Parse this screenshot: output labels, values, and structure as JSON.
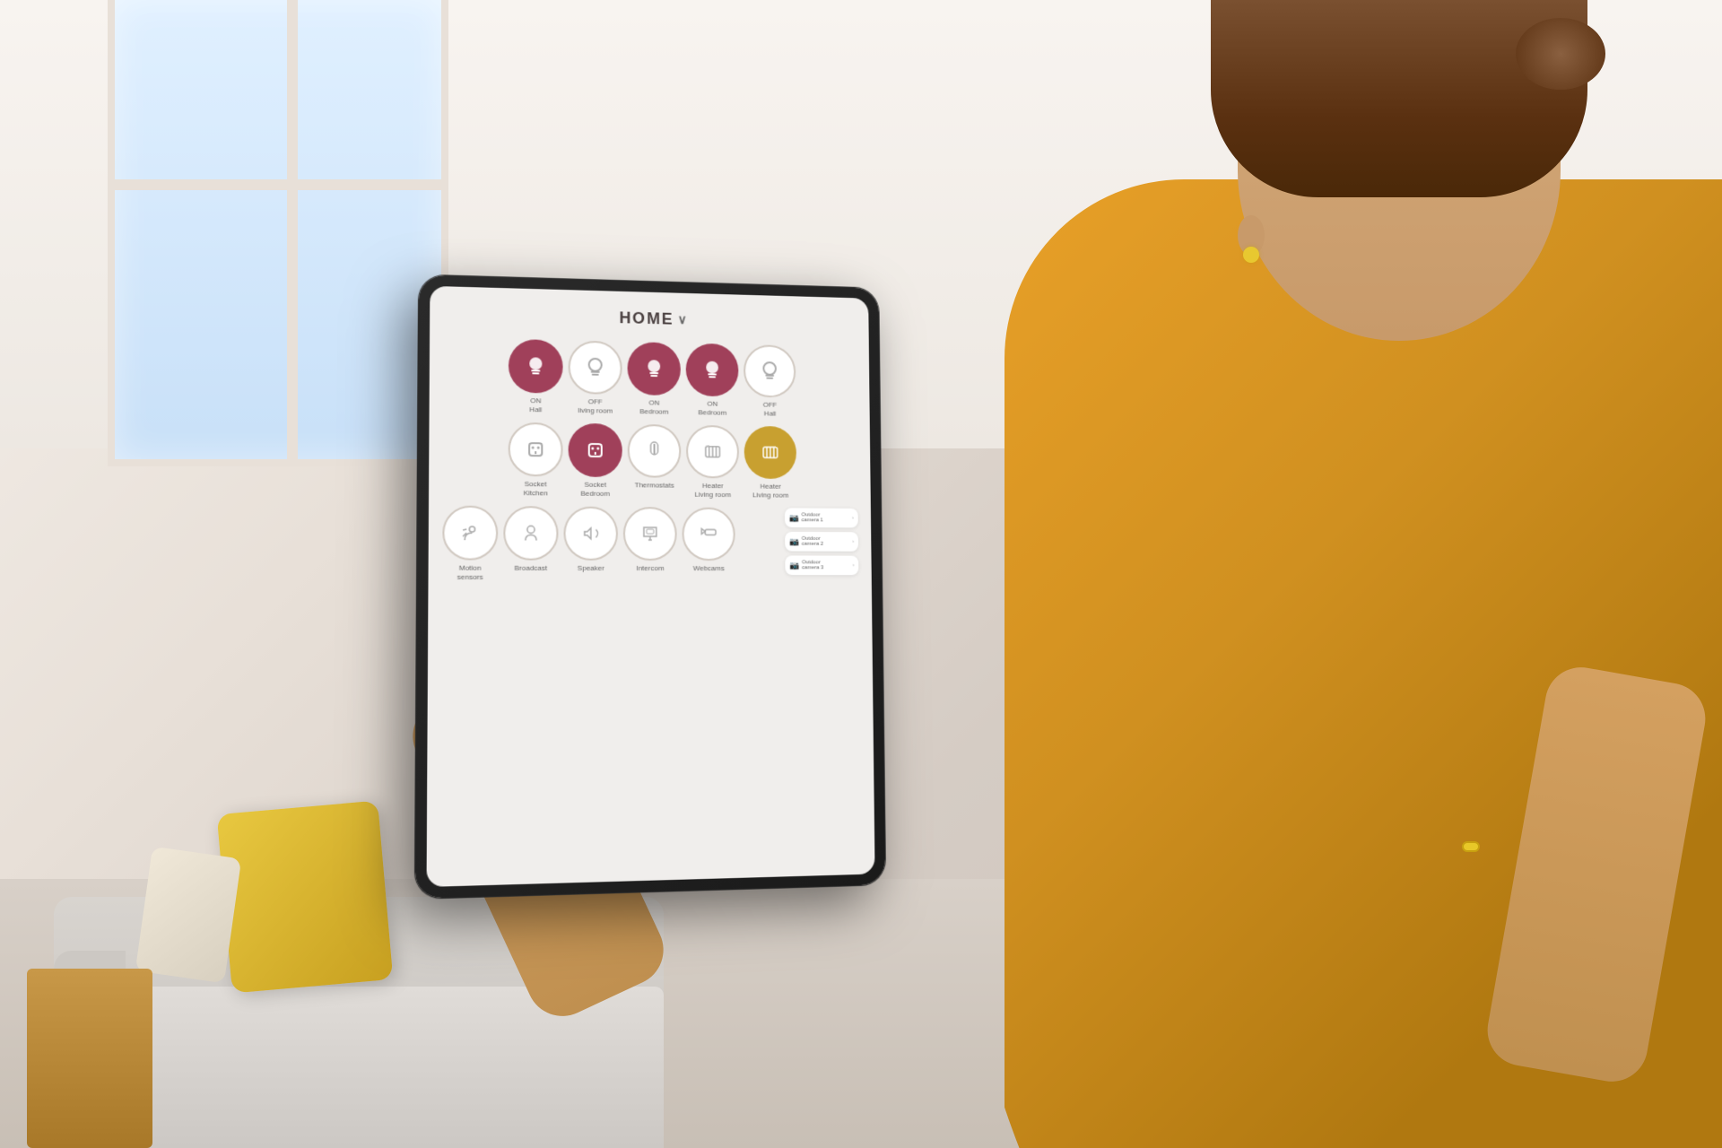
{
  "app": {
    "title": "HOME",
    "title_arrow": "∨"
  },
  "devices": {
    "row1": [
      {
        "label": "ON\nHall",
        "icon": "💡",
        "style": "active-pink",
        "icon_char": "💡"
      },
      {
        "label": "OFF\nliving room",
        "icon": "💡",
        "style": "inactive",
        "icon_char": "💡"
      },
      {
        "label": "ON\nBedroom",
        "icon": "💡",
        "style": "active-pink",
        "icon_char": "💡"
      },
      {
        "label": "ON\nBedroom",
        "icon": "💡",
        "style": "active-pink",
        "icon_char": "💡"
      },
      {
        "label": "OFF\nHall",
        "icon": "💡",
        "style": "inactive",
        "icon_char": "💡"
      }
    ],
    "row2": [
      {
        "label": "Socket\nKitchen",
        "icon": "🔌",
        "style": "inactive",
        "icon_char": "⬡"
      },
      {
        "label": "Socket\nBedroom",
        "icon": "🔌",
        "style": "active-pink",
        "icon_char": "⬡"
      },
      {
        "label": "Thermostats",
        "icon": "🌡",
        "style": "inactive",
        "icon_char": "🌡"
      },
      {
        "label": "Heater\nLiving room",
        "icon": "♨",
        "style": "inactive",
        "icon_char": "📄"
      },
      {
        "label": "Heater\nLiving room",
        "icon": "♨",
        "style": "gold",
        "icon_char": "📄"
      }
    ],
    "row3": [
      {
        "label": "Motion\nsensors",
        "icon": "🚶",
        "style": "inactive",
        "icon_char": "🚶"
      },
      {
        "label": "Broadcast",
        "icon": "👤",
        "style": "inactive",
        "icon_char": "👤"
      },
      {
        "label": "Speaker",
        "icon": "🎵",
        "style": "inactive",
        "icon_char": "🎵"
      },
      {
        "label": "Intercom",
        "icon": "🏠",
        "style": "inactive",
        "icon_char": "🏠"
      },
      {
        "label": "Webcams",
        "icon": "📷",
        "style": "inactive",
        "icon_char": "✏"
      }
    ]
  },
  "side_panel": {
    "items": [
      {
        "label": "Outdoor camera 1",
        "icon": "📷"
      },
      {
        "label": "Outdoor camera 2",
        "icon": "📷"
      },
      {
        "label": "Outdoor camera 3",
        "icon": "📷"
      }
    ],
    "arrow": ">"
  }
}
